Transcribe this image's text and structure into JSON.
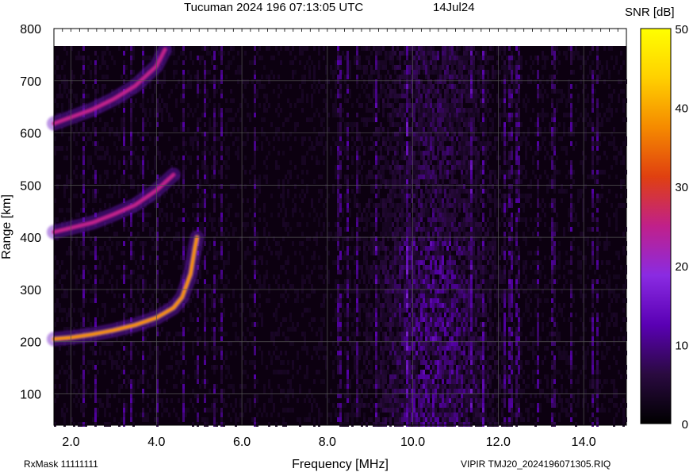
{
  "chart_data": {
    "type": "heatmap",
    "title": "Tucuman 2024 196 07:13:05 UTC",
    "date_label": "14Jul24",
    "xlabel": "Frequency [MHz]",
    "ylabel": "Range [km]",
    "x_ticks": [
      "2.0",
      "4.0",
      "6.0",
      "8.0",
      "10.0",
      "12.0",
      "14.0"
    ],
    "y_ticks": [
      "100",
      "200",
      "300",
      "400",
      "500",
      "600",
      "700",
      "800"
    ],
    "xlim": [
      1.6,
      15.0
    ],
    "ylim": [
      40,
      800
    ],
    "colorbar": {
      "label": "SNR [dB]",
      "ticks": [
        "0",
        "10",
        "20",
        "30",
        "40",
        "50"
      ],
      "range": [
        0,
        50
      ],
      "colors": [
        "#000000",
        "#2a0a40",
        "#5a00b4",
        "#8a2be2",
        "#c0208a",
        "#e04010",
        "#f58a00",
        "#ffd000",
        "#ffff00"
      ]
    },
    "traces": [
      {
        "name": "",
        "points": [
          [
            1.6,
            205
          ],
          [
            2.0,
            208
          ],
          [
            2.5,
            214
          ],
          [
            3.0,
            222
          ],
          [
            3.5,
            232
          ],
          [
            4.0,
            246
          ],
          [
            4.4,
            265
          ],
          [
            4.6,
            285
          ],
          [
            4.8,
            330
          ],
          [
            4.9,
            380
          ],
          [
            4.95,
            400
          ]
        ],
        "snr": 38
      },
      {
        "name": "",
        "points": [
          [
            1.6,
            410
          ],
          [
            2.0,
            418
          ],
          [
            2.5,
            428
          ],
          [
            3.0,
            444
          ],
          [
            3.5,
            462
          ],
          [
            4.0,
            490
          ],
          [
            4.4,
            520
          ]
        ],
        "snr": 25
      },
      {
        "name": "",
        "points": [
          [
            1.6,
            618
          ],
          [
            2.0,
            630
          ],
          [
            2.5,
            645
          ],
          [
            3.0,
            665
          ],
          [
            3.5,
            690
          ],
          [
            4.0,
            728
          ],
          [
            4.2,
            760
          ]
        ],
        "snr": 25
      }
    ],
    "grid": true
  },
  "footer": {
    "rxmask": "RxMask 11111111",
    "file": "VIPIR  TMJ20_2024196071305.RIQ"
  }
}
